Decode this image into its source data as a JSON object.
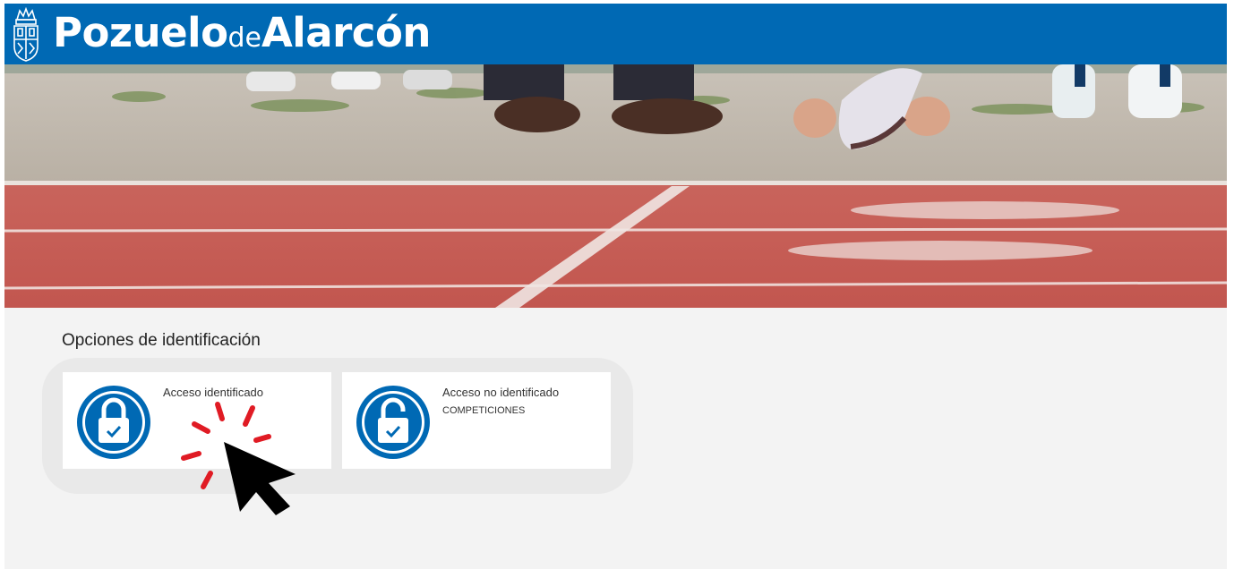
{
  "header": {
    "brand_pozuelo": "Pozuelo",
    "brand_de": "de",
    "brand_alarcon": "Alarcón",
    "color": "#0069b4"
  },
  "section": {
    "title": "Opciones de identificación"
  },
  "options": [
    {
      "label": "Acceso identificado",
      "sublabel": "",
      "icon": "lock-closed-icon"
    },
    {
      "label": "Acceso no identificado",
      "sublabel": "COMPETICIONES",
      "icon": "lock-open-icon"
    }
  ],
  "colors": {
    "accent": "#0069b4",
    "track": "#c85a52",
    "click_marks": "#e01b24"
  }
}
